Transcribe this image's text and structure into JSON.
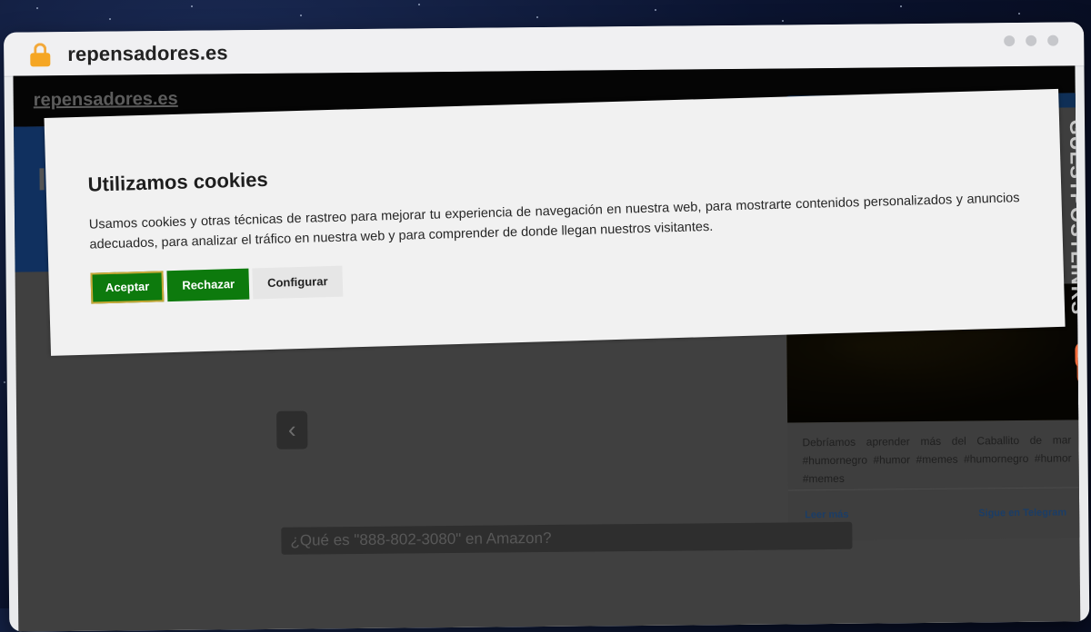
{
  "browser": {
    "address_title": "repensadores.es"
  },
  "site": {
    "logo": "repensadores.es",
    "prev_arrow": "‹",
    "search_banner": "¿Qué es \"888-802-3080\" en Amazon?",
    "side_card": {
      "text": "Debríamos aprender más del Caballito de mar #humornegro #humor #memes #humornegro #humor #memes",
      "read_more": "Leer más",
      "telegram": "Sigue en Telegram"
    }
  },
  "cookie_dialog": {
    "title": "Utilizamos cookies",
    "body": "Usamos cookies y otras técnicas de rastreo para mejorar tu experiencia de navegación en nuestra web, para mostrarte contenidos personalizados y anuncios adecuados, para analizar el tráfico en nuestra web y para comprender de donde llegan nuestros visitantes.",
    "accept_label": "Aceptar",
    "reject_label": "Rechazar",
    "configure_label": "Configurar"
  },
  "watermark": {
    "text": "GUESTPOSTLINKS"
  },
  "colors": {
    "accept_bg": "#0d7a0d",
    "reject_bg": "#0d7a0d",
    "lock": "#f5a623",
    "watermark_accent": "#f26b3a"
  },
  "icons": [
    "lock-icon",
    "window-dot-icon",
    "chevron-left-icon",
    "chain-link-icon"
  ]
}
